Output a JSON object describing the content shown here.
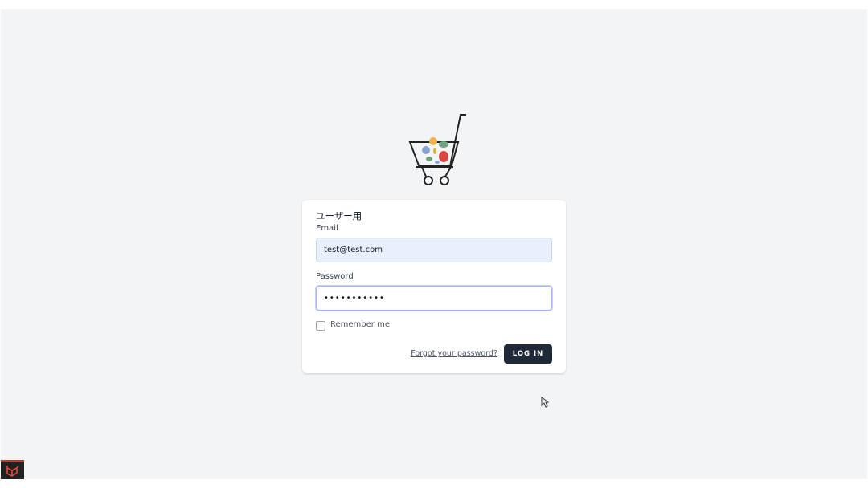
{
  "login": {
    "title": "ユーザー用",
    "email_label": "Email",
    "email_value": "test@test.com",
    "password_label": "Password",
    "password_value": "password123",
    "remember_label": "Remember me",
    "forgot_label": "Forgot your password?",
    "login_label": "LOG IN"
  },
  "colors": {
    "page_bg": "#f3f4f6",
    "button_bg": "#1f2937",
    "autofill_bg": "#e8f0fe"
  },
  "icons": {
    "logo": "shopping-cart-logo",
    "badge": "laravel-icon",
    "cursor": "mouse-pointer-icon"
  }
}
